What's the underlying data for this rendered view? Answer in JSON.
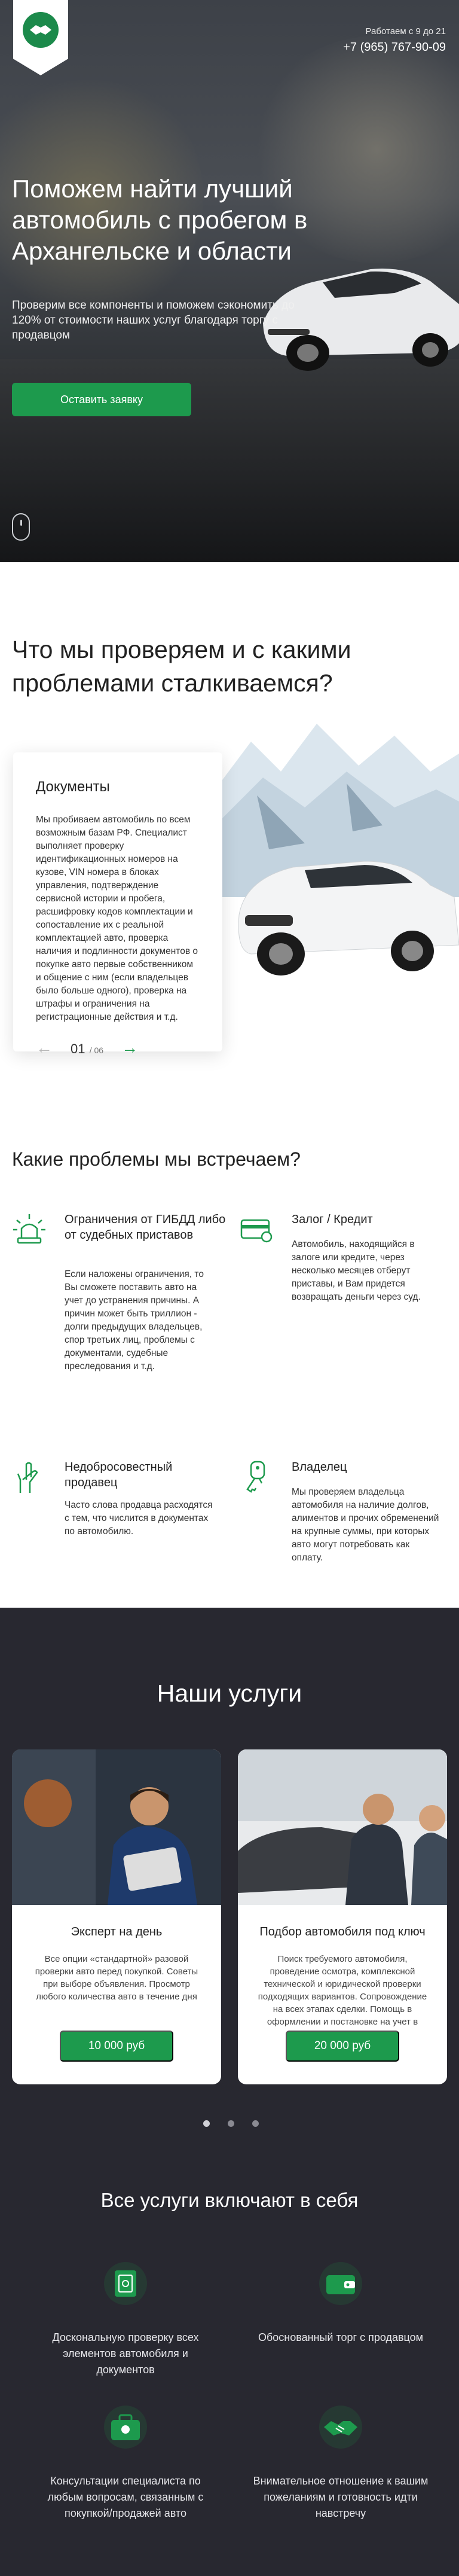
{
  "header": {
    "work_hours": "Работаем с 9 до 21",
    "phone": "+7 (965) 767-90-09"
  },
  "hero": {
    "title": "Поможем найти лучший автомобиль с пробегом в Архангельске и области",
    "subtitle": "Проверим все компоненты и поможем сэкономить до 120% от стоимости наших услуг благодаря торгу с продавцом",
    "cta_label": "Оставить заявку"
  },
  "check": {
    "heading": "Что мы проверяем и с какими проблемами сталкиваемся?",
    "card": {
      "title": "Документы",
      "text": "Мы пробиваем автомобиль по всем возможным базам РФ. Специалист выполняет проверку идентификационных номеров на кузове, VIN номера в блоках управления, подтверждение сервисной истории и пробега, расшифровку кодов комплектации и сопоставление их с реальной комплектацией авто, проверка наличия и подлинности документов о покупке авто первые собственником и общение с ним (если владельцев было больше одного), проверка на штрафы и ограничения на регистрационные действия и т.д."
    },
    "pager": {
      "current": "01",
      "total": "/ 06"
    }
  },
  "problems": {
    "heading": "Какие проблемы мы встречаем?",
    "items": [
      {
        "icon": "police-siren-icon",
        "title": "Ограничения от ГИБДД либо от судебных приставов",
        "text": "Если наложены ограничения, то Вы сможете поставить авто на учет до устранения причины. А причин может быть триллион - долги предыдущих владельцев, спор третьих лиц, проблемы с документами, судебные преследования и т.д."
      },
      {
        "icon": "credit-card-icon",
        "title": "Залог / Кредит",
        "text": "Автомобиль, находящийся в залоге или кредите, через несколько месяцев отберут приставы, и Вам придется возвращать деньги через суд."
      },
      {
        "icon": "crossed-fingers-icon",
        "title": "Недобросовестный продавец",
        "text": "Часто слова продавца расходятся с тем, что числится в документах по автомобилю."
      },
      {
        "icon": "car-key-icon",
        "title": "Владелец",
        "text": "Мы проверяем владельца автомобиля на наличие долгов, алиментов и прочих обременений на крупные суммы, при которых авто могут потребовать как оплату."
      }
    ]
  },
  "services": {
    "heading": "Наши услуги",
    "cards": [
      {
        "title": "Эксперт на день",
        "text": "Все опции «стандартной» разовой проверки авто перед покупкой. Советы при выборе объявления. Просмотр любого количества авто в течение дня",
        "price": "10 000 руб"
      },
      {
        "title": "Подбор автомобиля под ключ",
        "text": "Поиск требуемого автомобиля, проведение осмотра, комплексной технической и юридической проверки подходящих вариантов. Сопровождение на всех этапах сделки. Помощь в оформлении и постановке на учет в ГИБДД",
        "price": "20 000 руб"
      }
    ]
  },
  "includes": {
    "heading": "Все услуги включают в себя",
    "items": [
      {
        "icon": "safe-document-icon",
        "text": "Доскональную проверку всех элементов автомобиля и документов"
      },
      {
        "icon": "wallet-icon",
        "text": "Обоснованный торг с продавцом"
      },
      {
        "icon": "specialist-briefcase-icon",
        "text": "Консультации специалиста по любым вопросам, связанным с покупкой/продажей авто"
      },
      {
        "icon": "handshake-icon",
        "text": "Внимательное отношение к вашим пожеланиям и готовность идти навстречу"
      }
    ]
  },
  "colors": {
    "accent": "#1d9a4d",
    "dark_bg": "#282830"
  }
}
